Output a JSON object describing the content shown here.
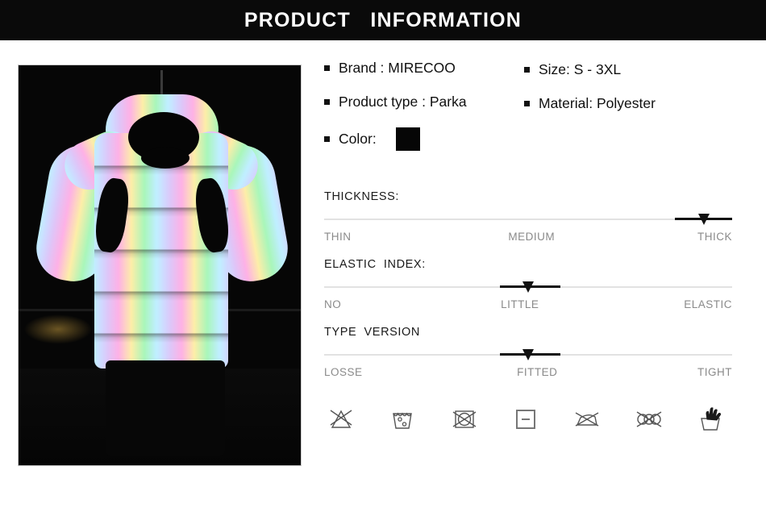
{
  "header": {
    "title": "PRODUCT   INFORMATION"
  },
  "product_image": {
    "alt": "reflective-holographic-puffer-jacket"
  },
  "specs": {
    "left": [
      {
        "label": "Brand : MIRECOO"
      },
      {
        "label": "Product type : Parka"
      },
      {
        "label": "Color:"
      }
    ],
    "right": [
      {
        "label": "Size: S - 3XL"
      },
      {
        "label": "Material: Polyester"
      }
    ],
    "color_swatch": "#060606"
  },
  "sliders": [
    {
      "title": "THICKNESS:",
      "labels": [
        "THIN",
        "MEDIUM",
        "THICK"
      ],
      "marker_percent": 93,
      "fill_start_percent": 86,
      "fill_end_percent": 100,
      "selected": "THICK"
    },
    {
      "title": "ELASTIC  INDEX:",
      "labels": [
        "NO",
        "LITTLE",
        "ELASTIC"
      ],
      "marker_percent": 50,
      "fill_start_percent": 43,
      "fill_end_percent": 58,
      "selected": "LITTLE"
    },
    {
      "title": "TYPE  VERSION",
      "labels": [
        "LOSSE",
        "FITTED",
        "TIGHT"
      ],
      "marker_percent": 50,
      "fill_start_percent": 43,
      "fill_end_percent": 58,
      "selected": "FITTED"
    }
  ],
  "care_symbols": [
    {
      "name": "do-not-bleach-icon",
      "title": "Do not bleach"
    },
    {
      "name": "machine-wash-icon",
      "title": "Machine wash"
    },
    {
      "name": "do-not-tumble-dry-icon",
      "title": "Do not tumble dry"
    },
    {
      "name": "dry-flat-icon",
      "title": "Dry flat"
    },
    {
      "name": "do-not-iron-icon",
      "title": "Do not iron"
    },
    {
      "name": "do-not-dry-clean-icon",
      "title": "Do not dry clean"
    },
    {
      "name": "hand-wash-icon",
      "title": "Hand wash"
    }
  ],
  "colors": {
    "header_bg": "#0a0a0a",
    "header_text": "#ffffff",
    "text": "#101010",
    "muted_text": "#8a8a8a",
    "track": "#e2e2e2",
    "marker": "#111111"
  }
}
